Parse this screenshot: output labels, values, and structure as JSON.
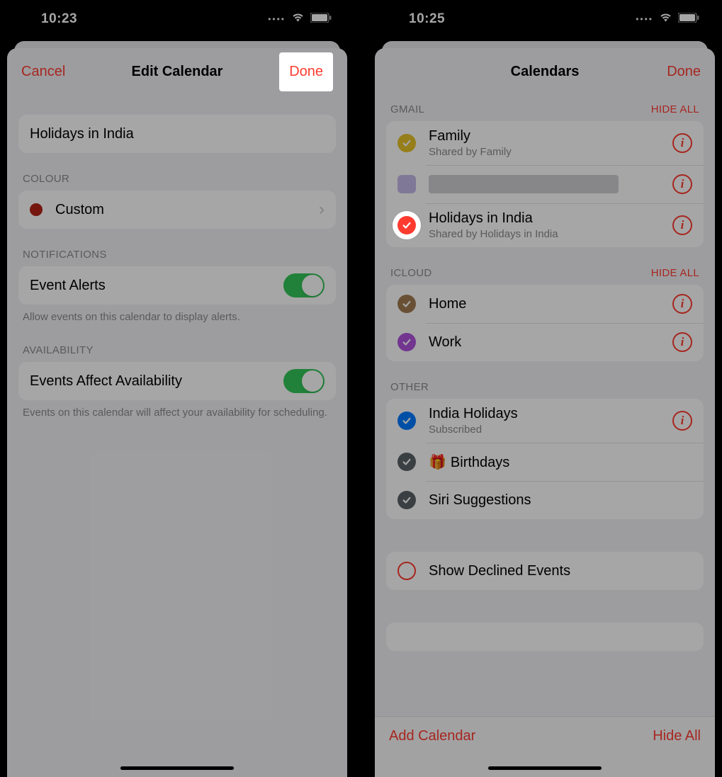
{
  "left": {
    "status_time": "10:23",
    "nav": {
      "cancel": "Cancel",
      "title": "Edit Calendar",
      "done": "Done"
    },
    "calendar_name": "Holidays in India",
    "colour": {
      "header": "COLOUR",
      "label": "Custom",
      "hex": "#b42318"
    },
    "notifications": {
      "header": "NOTIFICATIONS",
      "event_alerts": "Event Alerts",
      "footer": "Allow events on this calendar to display alerts."
    },
    "availability": {
      "header": "AVAILABILITY",
      "label": "Events Affect Availability",
      "footer": "Events on this calendar will affect your availability for scheduling."
    }
  },
  "right": {
    "status_time": "10:25",
    "nav": {
      "title": "Calendars",
      "done": "Done"
    },
    "sections": {
      "gmail": {
        "header": "GMAIL",
        "hide": "HIDE ALL",
        "items": [
          {
            "name": "Family",
            "sub": "Shared by Family",
            "color": "yellow"
          },
          {
            "name": "",
            "sub": "",
            "color": "lavender",
            "redacted": true
          },
          {
            "name": "Holidays in India",
            "sub": "Shared by Holidays in India",
            "color": "red",
            "highlighted": true
          }
        ]
      },
      "icloud": {
        "header": "ICLOUD",
        "hide": "HIDE ALL",
        "items": [
          {
            "name": "Home",
            "color": "brown"
          },
          {
            "name": "Work",
            "color": "purple"
          }
        ]
      },
      "other": {
        "header": "OTHER",
        "items": [
          {
            "name": "India Holidays",
            "sub": "Subscribed",
            "color": "blue"
          },
          {
            "name": "Birthdays",
            "color": "gray",
            "gift": true
          },
          {
            "name": "Siri Suggestions",
            "color": "gray"
          }
        ]
      },
      "declined": {
        "label": "Show Declined Events"
      }
    },
    "bottom": {
      "add": "Add Calendar",
      "hide_all": "Hide All"
    }
  }
}
